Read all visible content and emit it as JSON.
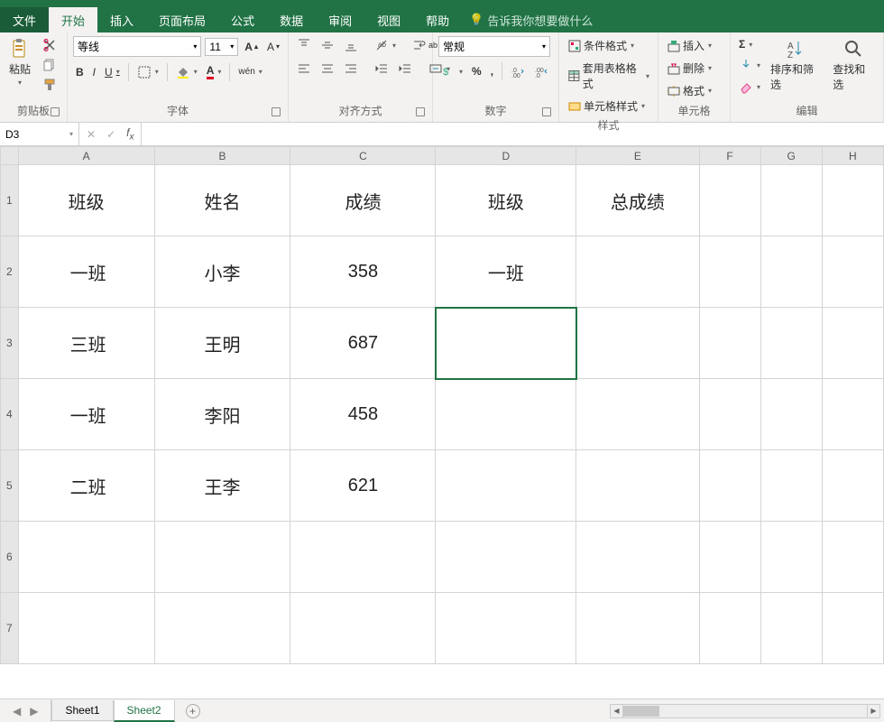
{
  "menu": {
    "file": "文件",
    "home": "开始",
    "insert": "插入",
    "layout": "页面布局",
    "formula": "公式",
    "data": "数据",
    "review": "审阅",
    "view": "视图",
    "help": "帮助",
    "tellme": "告诉我你想要做什么"
  },
  "ribbon": {
    "paste": "粘贴",
    "clipboard": "剪贴板",
    "font_name": "等线",
    "font_size": "11",
    "font_group": "字体",
    "wen": "wén",
    "align_group": "对齐方式",
    "wrap_glyph": "ab",
    "number_format": "常规",
    "number_group": "数字",
    "cond_format": "条件格式",
    "table_format": "套用表格格式",
    "cell_style": "单元格样式",
    "styles_group": "样式",
    "insert_btn": "插入",
    "delete_btn": "删除",
    "format_btn": "格式",
    "cells_group": "单元格",
    "sort_filter": "排序和筛选",
    "find_select": "查找和选",
    "editing_group": "编辑"
  },
  "namebox": "D3",
  "cols": [
    "A",
    "B",
    "C",
    "D",
    "E",
    "F",
    "G",
    "H"
  ],
  "rows": [
    "1",
    "2",
    "3",
    "4",
    "5",
    "6",
    "7"
  ],
  "cells": {
    "A1": "班级",
    "B1": "姓名",
    "C1": "成绩",
    "D1": "班级",
    "E1": "总成绩",
    "A2": "一班",
    "B2": "小李",
    "C2": "358",
    "D2": "一班",
    "A3": "三班",
    "B3": "王明",
    "C3": "687",
    "A4": "一班",
    "B4": "李阳",
    "C4": "458",
    "A5": "二班",
    "B5": "王李",
    "C5": "621"
  },
  "tabs": {
    "s1": "Sheet1",
    "s2": "Sheet2"
  },
  "chart_data": {
    "type": "table",
    "title": "",
    "columns": [
      "班级",
      "姓名",
      "成绩",
      "班级",
      "总成绩"
    ],
    "rows": [
      [
        "一班",
        "小李",
        358,
        "一班",
        null
      ],
      [
        "三班",
        "王明",
        687,
        null,
        null
      ],
      [
        "一班",
        "李阳",
        458,
        null,
        null
      ],
      [
        "二班",
        "王李",
        621,
        null,
        null
      ]
    ]
  }
}
